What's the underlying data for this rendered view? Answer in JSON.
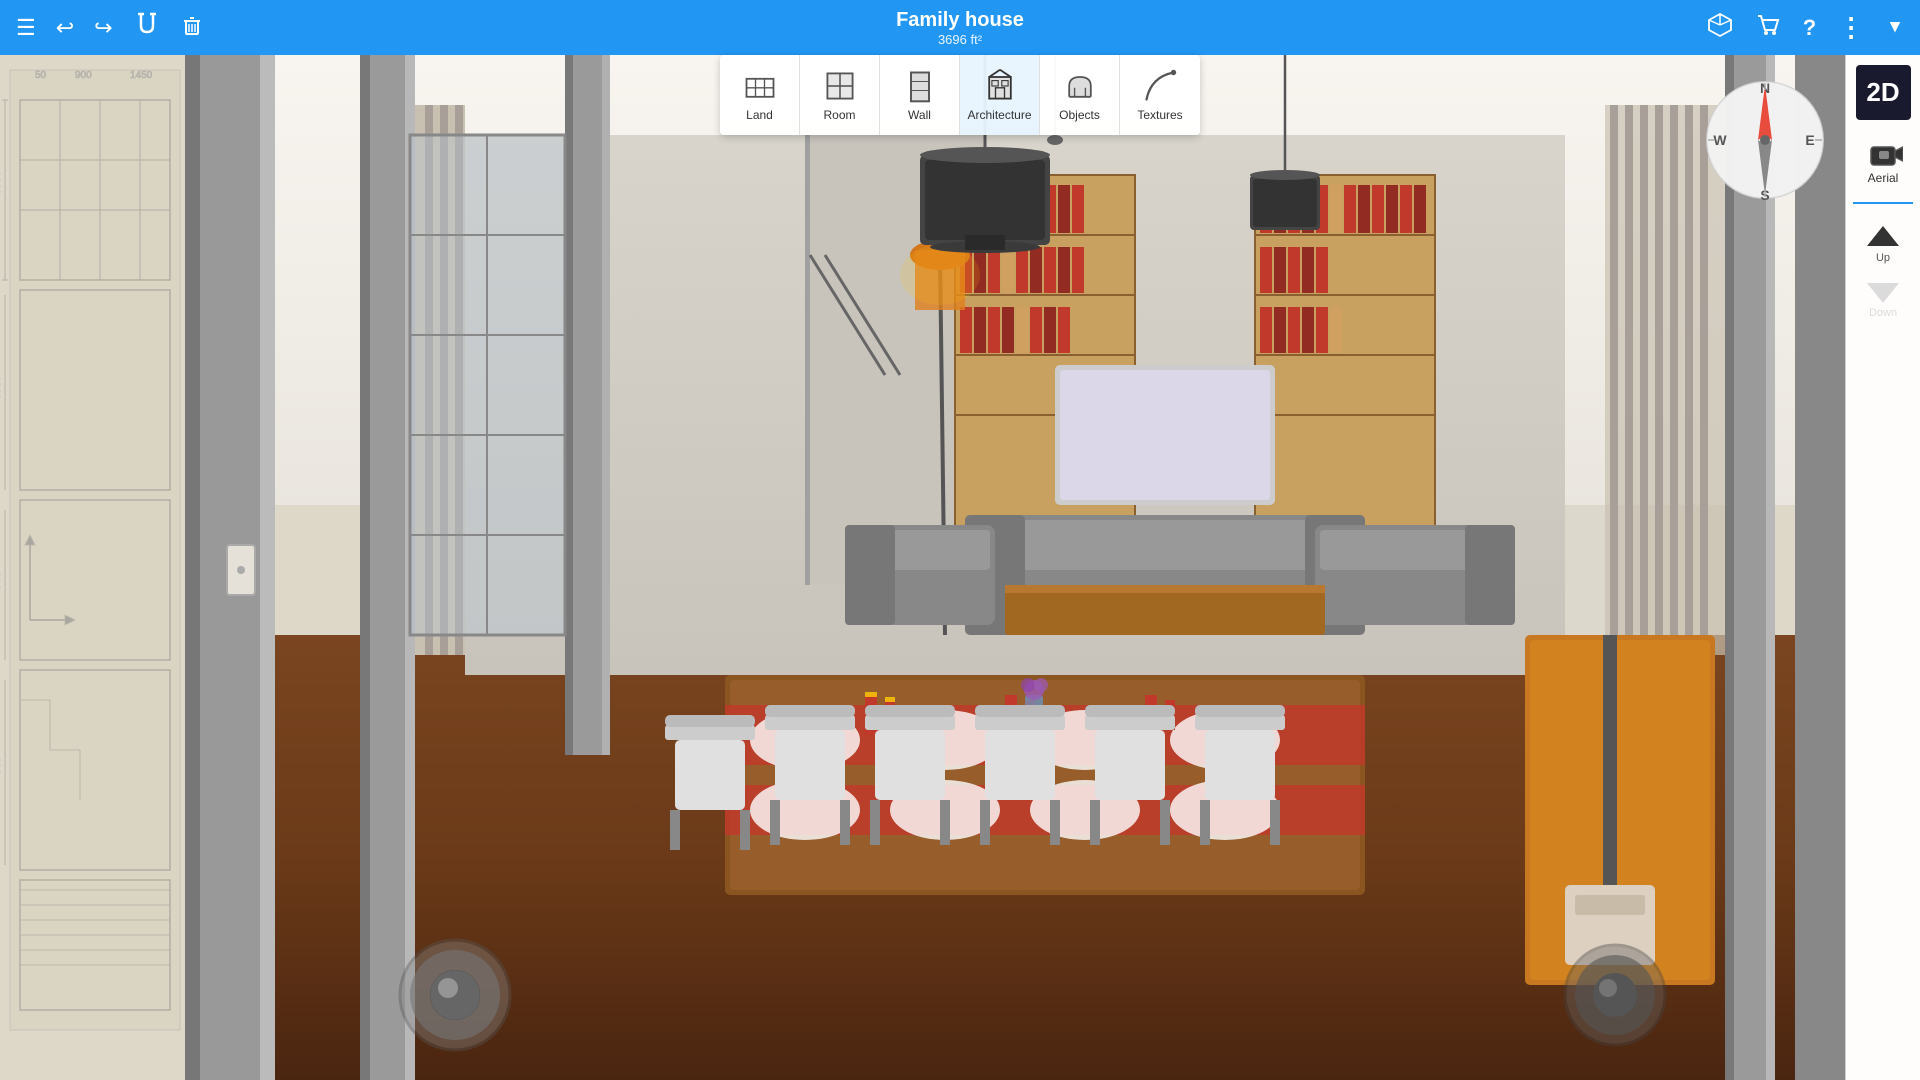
{
  "header": {
    "title": "Family house",
    "subtitle": "3696 ft²",
    "menu_icon": "☰",
    "undo_icon": "↩",
    "redo_icon": "↪",
    "magnet_icon": "⊕",
    "trash_icon": "🗑",
    "cube_icon": "⧫",
    "cart_icon": "🛒",
    "help_icon": "?",
    "more_icon": "⋮",
    "account_icon": "▲"
  },
  "toolbar": {
    "items": [
      {
        "id": "land",
        "label": "Land",
        "active": false
      },
      {
        "id": "room",
        "label": "Room",
        "active": false
      },
      {
        "id": "wall",
        "label": "Wall",
        "active": false
      },
      {
        "id": "architecture",
        "label": "Architecture",
        "active": true
      },
      {
        "id": "objects",
        "label": "Objects",
        "active": false
      },
      {
        "id": "textures",
        "label": "Textures",
        "active": false
      }
    ]
  },
  "view_controls": {
    "mode_2d": "2D",
    "aerial_label": "Aerial",
    "up_label": "Up",
    "down_label": "Down"
  },
  "compass": {
    "directions": [
      "N",
      "S",
      "E",
      "W"
    ]
  }
}
